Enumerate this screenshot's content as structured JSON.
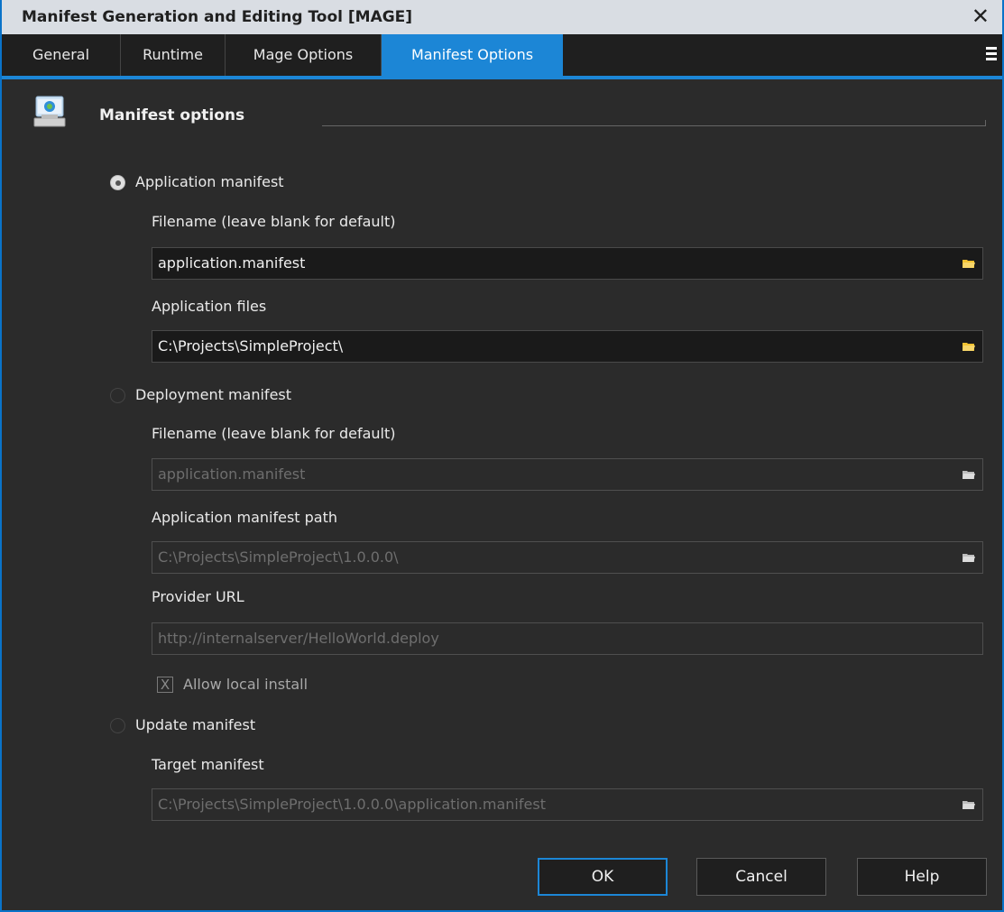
{
  "window": {
    "title": "Manifest Generation and Editing Tool [MAGE]"
  },
  "tabs": [
    {
      "label": "General"
    },
    {
      "label": "Runtime"
    },
    {
      "label": "Mage Options"
    },
    {
      "label": "Manifest Options"
    }
  ],
  "group": {
    "title": "Manifest options"
  },
  "application": {
    "radio_label": "Application manifest",
    "filename_label": "Filename (leave blank for default)",
    "filename_value": "application.manifest",
    "files_label": "Application files",
    "files_value": "C:\\Projects\\SimpleProject\\"
  },
  "deployment": {
    "radio_label": "Deployment manifest",
    "filename_label": "Filename (leave blank for default)",
    "filename_value": "application.manifest",
    "path_label": "Application manifest path",
    "path_value": "C:\\Projects\\SimpleProject\\1.0.0.0\\",
    "provider_label": "Provider URL",
    "provider_value": "http://internalserver/HelloWorld.deploy",
    "allow_local_label": "Allow local install",
    "allow_local_mark": "X"
  },
  "update": {
    "radio_label": "Update manifest",
    "target_label": "Target manifest",
    "target_value": "C:\\Projects\\SimpleProject\\1.0.0.0\\application.manifest"
  },
  "buttons": {
    "ok": "OK",
    "cancel": "Cancel",
    "help": "Help"
  },
  "close_glyph": "✕",
  "colors": {
    "accent": "#1c86d6",
    "folder_active": "#f2c232",
    "folder_disabled": "#cfcfcf"
  }
}
